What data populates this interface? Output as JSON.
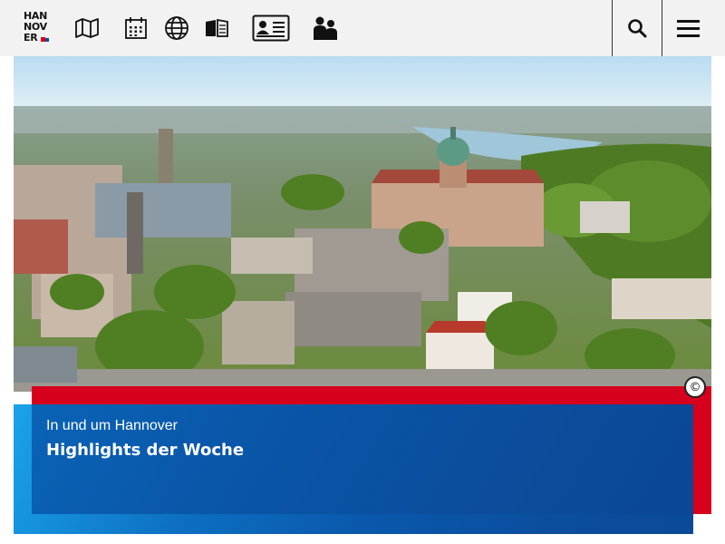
{
  "header": {
    "logo_lines": [
      "HAN",
      "NOV",
      "ER"
    ],
    "nav_icons": [
      "map-icon",
      "calendar-icon",
      "globe-icon",
      "book-icon",
      "id-card-icon",
      "people-icon"
    ],
    "search_icon": "search-icon",
    "menu_icon": "hamburger-menu-icon"
  },
  "hero": {
    "copyright_symbol": "©"
  },
  "teaser": {
    "subtitle": "In und um Hannover",
    "title": "Highlights der Woche"
  },
  "colors": {
    "header_bg": "#f2f2f2",
    "accent_red": "#d6001c",
    "teaser_blue": "#0a55a8",
    "teaser_light_blue": "#1aa3e8"
  }
}
